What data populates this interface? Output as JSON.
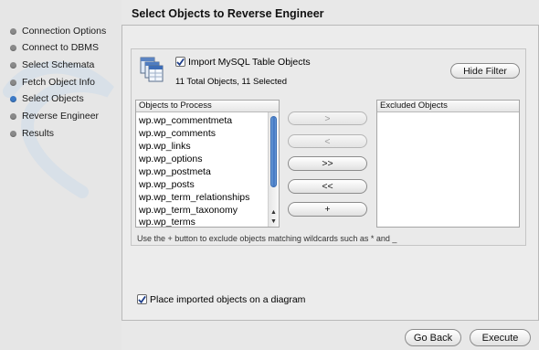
{
  "title": "Select Objects to Reverse Engineer",
  "sidebar": {
    "items": [
      {
        "label": "Connection Options",
        "active": false
      },
      {
        "label": "Connect to DBMS",
        "active": false
      },
      {
        "label": "Select Schemata",
        "active": false
      },
      {
        "label": "Fetch Object Info",
        "active": false
      },
      {
        "label": "Select Objects",
        "active": true
      },
      {
        "label": "Reverse Engineer",
        "active": false
      },
      {
        "label": "Results",
        "active": false
      }
    ]
  },
  "import_section": {
    "checkbox_label": "Import MySQL Table Objects",
    "checked": true,
    "summary": "11 Total Objects, 11 Selected",
    "hide_filter_label": "Hide Filter"
  },
  "objects_to_process": {
    "header": "Objects to Process",
    "items": [
      "wp.wp_commentmeta",
      "wp.wp_comments",
      "wp.wp_links",
      "wp.wp_options",
      "wp.wp_postmeta",
      "wp.wp_posts",
      "wp.wp_term_relationships",
      "wp.wp_term_taxonomy",
      "wp.wp_terms"
    ]
  },
  "excluded_objects": {
    "header": "Excluded Objects",
    "items": []
  },
  "transfer_buttons": {
    "move_right": ">",
    "move_left": "<",
    "move_all_right": ">>",
    "move_all_left": "<<",
    "add_wildcard": "+"
  },
  "hint": "Use the + button to exclude objects matching wildcards such as * and _",
  "diagram": {
    "checkbox_label": "Place imported objects on a diagram",
    "checked": true
  },
  "footer": {
    "back_label": "Go Back",
    "execute_label": "Execute"
  },
  "colors": {
    "active_dot": "#3d7ac6",
    "inactive_dot": "#8a8a8a",
    "scroll_thumb": "#3f74c1"
  }
}
